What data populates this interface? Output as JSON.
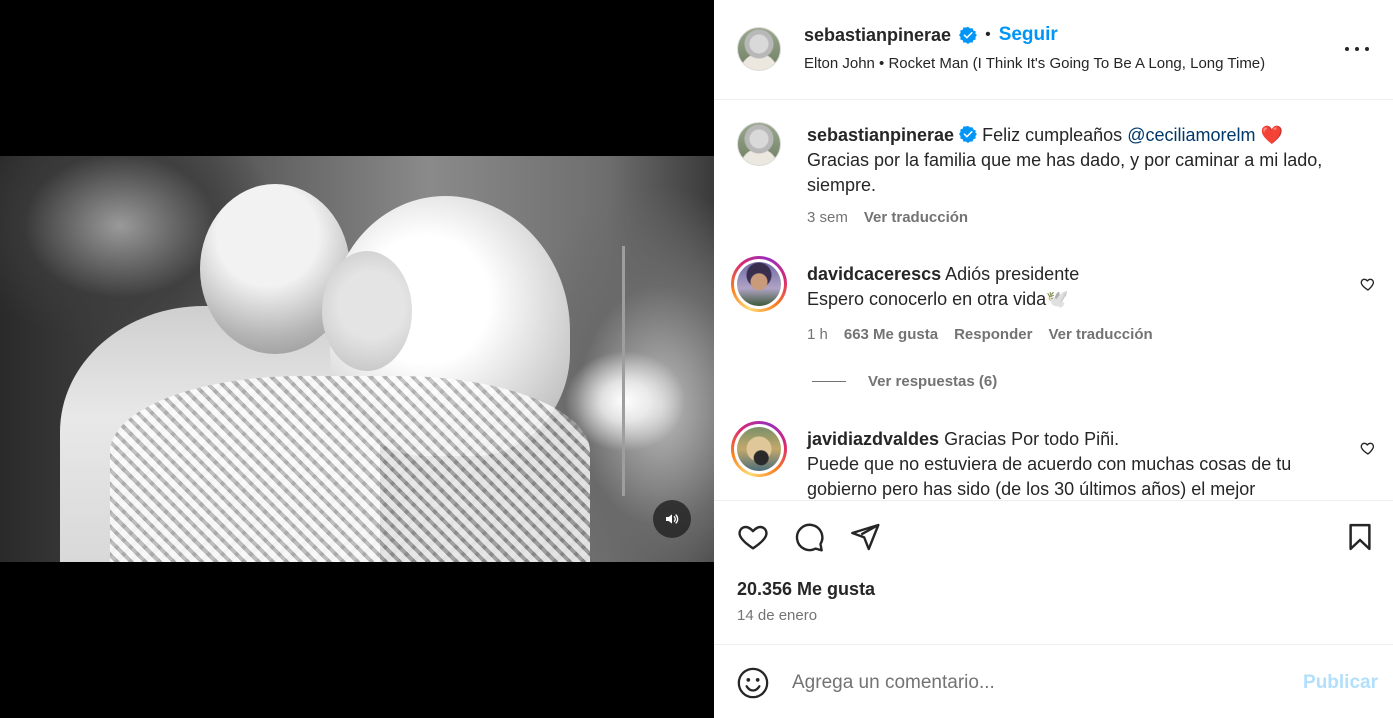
{
  "header": {
    "username": "sebastianpinerae",
    "separator": "•",
    "follow_label": "Seguir",
    "music": "Elton John • Rocket Man (I Think It's Going To Be A Long, Long Time)"
  },
  "caption": {
    "username": "sebastianpinerae",
    "text_before": "Feliz cumpleaños ",
    "mention": "@ceciliamorelm",
    "emoji": "❤️",
    "text_line2": "Gracias por la familia que me has dado, y por caminar a mi lado, siempre.",
    "time": "3 sem",
    "translate": "Ver traducción"
  },
  "comments": [
    {
      "username": "davidcacerescs",
      "text1": "Adiós presidente",
      "text2": "Espero conocerlo en otra vida🕊️",
      "time": "1 h",
      "likes": "663 Me gusta",
      "reply": "Responder",
      "translate": "Ver traducción",
      "view_replies": "Ver respuestas (6)"
    },
    {
      "username": "javidiazdvaldes",
      "text1": "Gracias Por todo Piñi.",
      "text2": "Puede que no estuviera de acuerdo con muchas cosas de tu gobierno pero has sido (de los 30 últimos años) el mejor"
    }
  ],
  "stats": {
    "likes": "20.356 Me gusta",
    "date": "14 de enero"
  },
  "composer": {
    "placeholder": "Agrega un comentario...",
    "publish": "Publicar"
  },
  "icons": {
    "verified": "verified-badge-icon",
    "more": "more-options-icon",
    "like": "heart-icon",
    "comment": "comment-icon",
    "share": "share-icon",
    "save": "bookmark-icon",
    "emoji": "emoji-icon",
    "sound": "speaker-icon"
  },
  "colors": {
    "accent": "#0095f6",
    "muted": "#737373",
    "text": "#262626",
    "publish_disabled": "#b2dffc"
  }
}
